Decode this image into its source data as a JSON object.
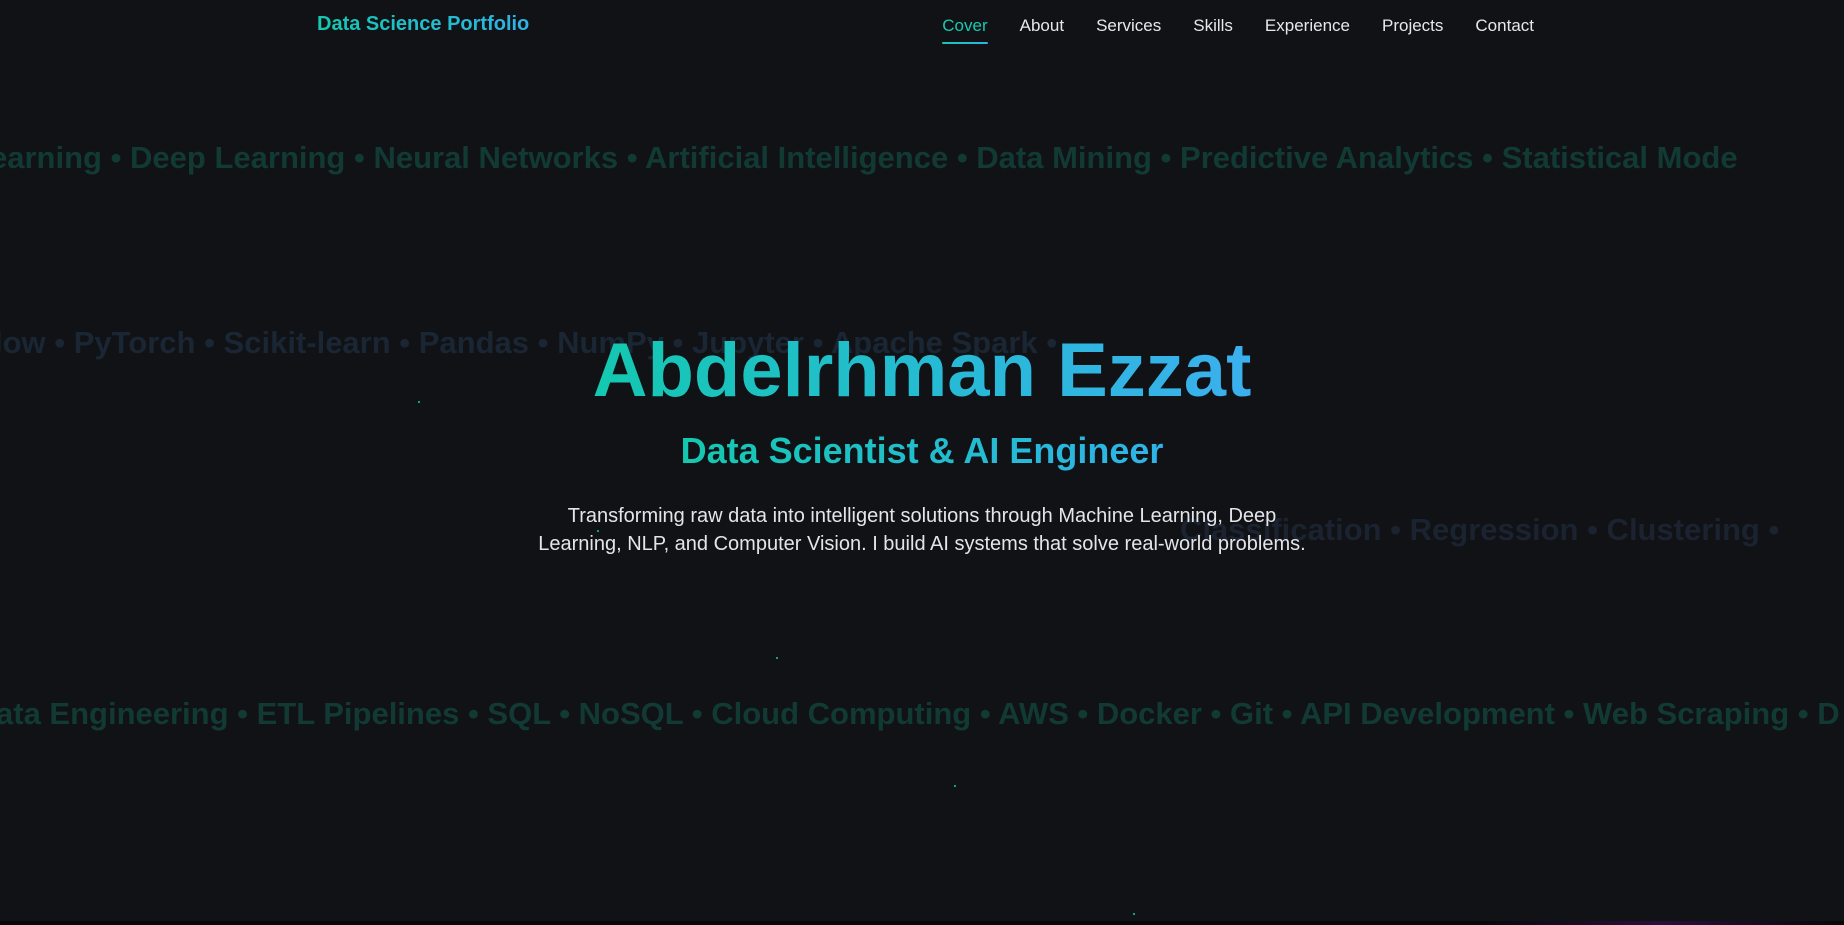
{
  "nav": {
    "brand": "Data Science Portfolio",
    "links": [
      {
        "label": "Cover",
        "active": true
      },
      {
        "label": "About",
        "active": false
      },
      {
        "label": "Services",
        "active": false
      },
      {
        "label": "Skills",
        "active": false
      },
      {
        "label": "Experience",
        "active": false
      },
      {
        "label": "Projects",
        "active": false
      },
      {
        "label": "Contact",
        "active": false
      }
    ]
  },
  "background_strips": [
    "earning • Deep Learning • Neural Networks • Artificial Intelligence • Data Mining • Predictive Analytics • Statistical Mode",
    "low • PyTorch • Scikit-learn • Pandas • NumPy • Jupyter • Apache Spark •",
    "Classification • Regression • Clustering •",
    "ata Engineering • ETL Pipelines • SQL • NoSQL • Cloud Computing • AWS • Docker • Git • API Development • Web Scraping • D"
  ],
  "hero": {
    "name": "Abdelrhman Ezzat",
    "role": "Data Scientist & AI Engineer",
    "description": "Transforming raw data into intelligent solutions through Machine Learning, Deep Learning, NLP, and Computer Vision. I build AI systems that solve real-world problems."
  },
  "colors": {
    "background": "#101216",
    "accent_teal": "#14c8b0",
    "accent_blue": "#2fb3e8",
    "text": "#e3e5ea"
  }
}
